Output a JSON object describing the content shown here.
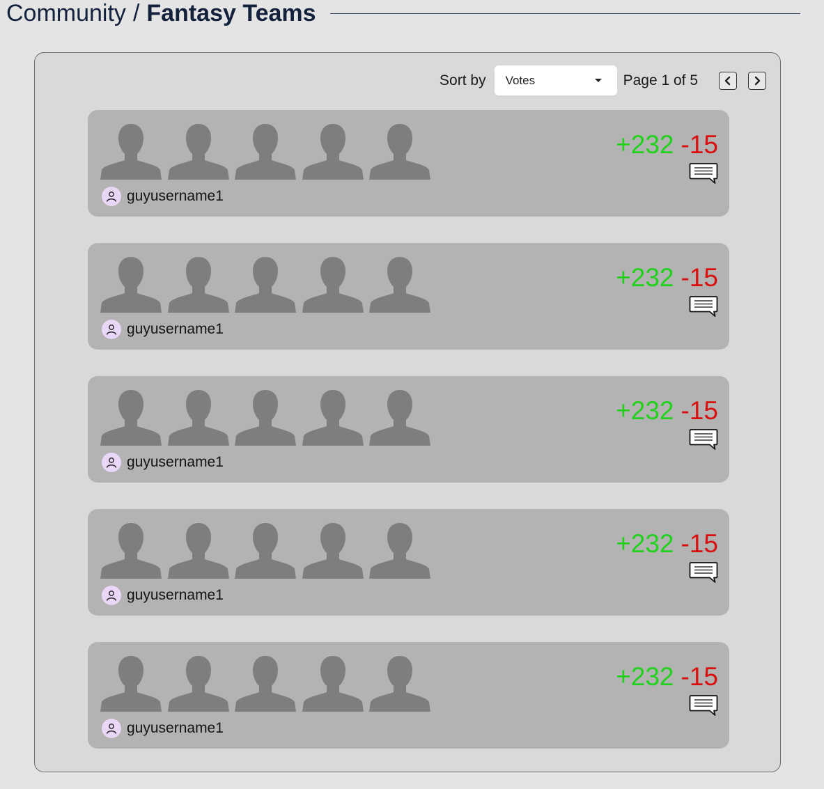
{
  "breadcrumb": {
    "section": "Community",
    "separator": "/",
    "current": "Fantasy Teams"
  },
  "toolbar": {
    "sort_label": "Sort by",
    "sort_selected": "Votes",
    "page_label": "Page 1 of 5",
    "prev_icon": "chevron-left-icon",
    "next_icon": "chevron-right-icon"
  },
  "colors": {
    "upvote": "#22d11c",
    "downvote": "#d90f0f",
    "title": "#14213d"
  },
  "teams": [
    {
      "username": "guyusername1",
      "upvotes": "+232",
      "downvotes": "-15"
    },
    {
      "username": "guyusername1",
      "upvotes": "+232",
      "downvotes": "-15"
    },
    {
      "username": "guyusername1",
      "upvotes": "+232",
      "downvotes": "-15"
    },
    {
      "username": "guyusername1",
      "upvotes": "+232",
      "downvotes": "-15"
    },
    {
      "username": "guyusername1",
      "upvotes": "+232",
      "downvotes": "-15"
    }
  ]
}
